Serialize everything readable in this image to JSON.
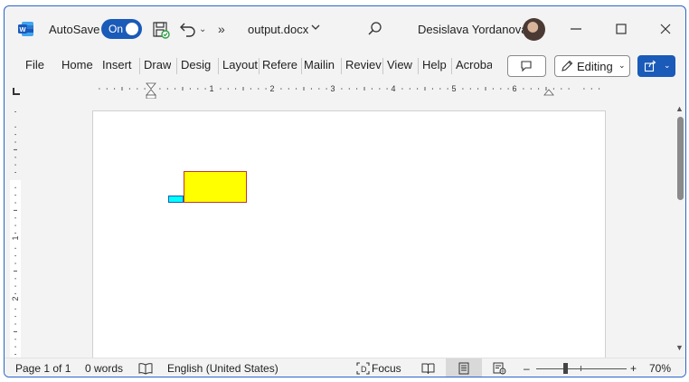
{
  "titlebar": {
    "autosave_label": "AutoSave",
    "autosave_state": "On",
    "more_label": "»",
    "doc_title": "output.docx",
    "user_name": "Desislava Yordanova"
  },
  "ribbon": {
    "tabs": [
      {
        "label": "File"
      },
      {
        "label": "Home"
      },
      {
        "label": "Insert"
      },
      {
        "label": "Draw"
      },
      {
        "label": "Desig"
      },
      {
        "label": "Layout"
      },
      {
        "label": "Refere"
      },
      {
        "label": "Mailin"
      },
      {
        "label": "Reviev"
      },
      {
        "label": "View"
      },
      {
        "label": "Help"
      },
      {
        "label": "Acroba"
      }
    ],
    "editing_label": "Editing"
  },
  "hruler": {
    "labels": [
      "1",
      "2",
      "3",
      "4",
      "5",
      "6"
    ]
  },
  "vruler": {
    "labels": [
      "1",
      "2",
      "3"
    ]
  },
  "document": {
    "shapes": [
      {
        "name": "yellow-rectangle",
        "fill": "#ffff00",
        "stroke": "#c0392b"
      },
      {
        "name": "cyan-rectangle",
        "fill": "#00ffff",
        "stroke": "#1a5ab8"
      }
    ]
  },
  "statusbar": {
    "page_info": "Page 1 of 1",
    "word_count": "0 words",
    "language": "English (United States)",
    "focus_label": "Focus",
    "zoom_minus": "–",
    "zoom_plus": "+",
    "zoom_level": "70%"
  },
  "colors": {
    "accent": "#1a5ab8",
    "window_bg": "#f3f3f3"
  }
}
